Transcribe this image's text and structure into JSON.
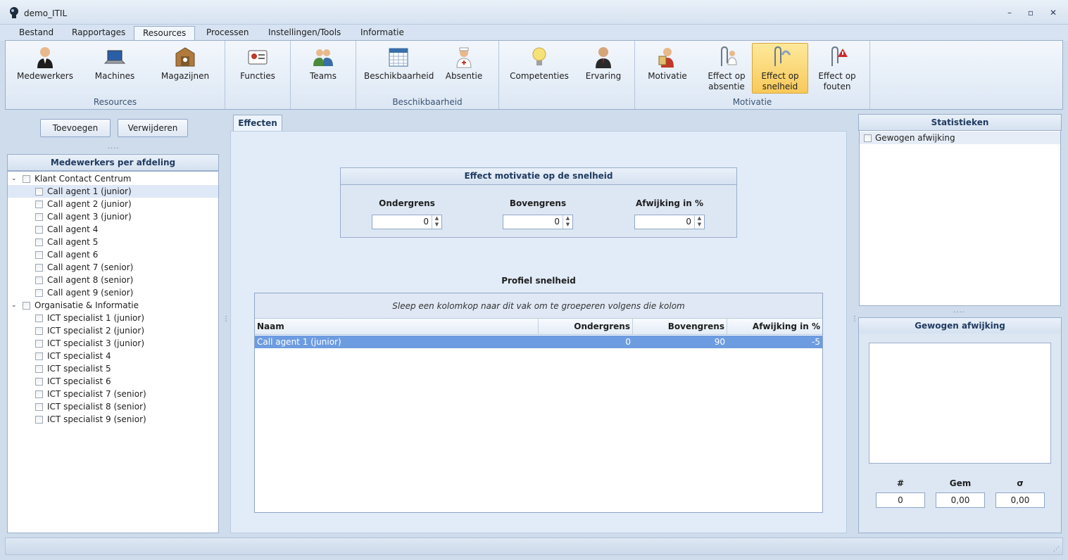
{
  "window": {
    "title": "demo_ITIL",
    "controls": [
      "–",
      "▫",
      "✕"
    ]
  },
  "tabs": [
    "Bestand",
    "Rapportages",
    "Resources",
    "Processen",
    "Instellingen/Tools",
    "Informatie"
  ],
  "active_tab": "Resources",
  "ribbon": {
    "groups": [
      {
        "label": "Resources",
        "buttons": [
          "Medewerkers",
          "Machines",
          "Magazijnen"
        ]
      },
      {
        "label": "",
        "buttons": [
          "Functies"
        ]
      },
      {
        "label": "",
        "buttons": [
          "Teams"
        ]
      },
      {
        "label": "Beschikbaarheid",
        "buttons": [
          "Beschikbaarheid",
          "Absentie"
        ]
      },
      {
        "label": "",
        "buttons": [
          "Competenties",
          "Ervaring"
        ]
      },
      {
        "label": "Motivatie",
        "buttons": [
          "Motivatie",
          "Effect op absentie",
          "Effect op snelheid",
          "Effect op fouten"
        ]
      }
    ],
    "active_button": "Effect op snelheid",
    "motivatie_lines": {
      "absentie": [
        "Effect op",
        "absentie"
      ],
      "snelheid": [
        "Effect op",
        "snelheid"
      ],
      "fouten": [
        "Effect op",
        "fouten"
      ]
    }
  },
  "left": {
    "add_button": "Toevoegen",
    "remove_button": "Verwijderen",
    "dots": "....",
    "panel_title": "Medewerkers per afdeling",
    "groups": [
      {
        "name": "Klant Contact Centrum",
        "items": [
          "Call agent 1 (junior)",
          "Call agent 2 (junior)",
          "Call agent 3 (junior)",
          "Call agent 4",
          "Call agent 5",
          "Call agent 6",
          "Call agent 7 (senior)",
          "Call agent 8 (senior)",
          "Call agent 9 (senior)"
        ]
      },
      {
        "name": "Organisatie & Informatie",
        "items": [
          "ICT specialist 1 (junior)",
          "ICT specialist 2 (junior)",
          "ICT specialist 3 (junior)",
          "ICT specialist 4",
          "ICT specialist 5",
          "ICT specialist 6",
          "ICT specialist 7 (senior)",
          "ICT specialist 8 (senior)",
          "ICT specialist 9 (senior)"
        ]
      }
    ],
    "selected_item": "Call agent 1 (junior)"
  },
  "center": {
    "tab": "Effecten",
    "effect_title": "Effect motivatie op de snelheid",
    "fields": [
      {
        "label": "Ondergrens",
        "value": "0"
      },
      {
        "label": "Bovengrens",
        "value": "0"
      },
      {
        "label": "Afwijking in %",
        "value": "0"
      }
    ],
    "profile_title": "Profiel snelheid",
    "group_hint": "Sleep een kolomkop naar dit vak om te groeperen volgens die kolom",
    "columns": [
      "Naam",
      "Ondergrens",
      "Bovengrens",
      "Afwijking in %"
    ],
    "rows": [
      {
        "naam": "Call agent 1 (junior)",
        "ondergrens": "0",
        "bovengrens": "90",
        "afwijking": "-5"
      }
    ]
  },
  "right": {
    "stats_title": "Statistieken",
    "stats_items": [
      "Gewogen afwijking"
    ],
    "dots": "....",
    "chart_title": "Gewogen afwijking",
    "summary_labels": [
      "#",
      "Gem",
      "σ"
    ],
    "summary_values": [
      "0",
      "0,00",
      "0,00"
    ]
  },
  "colors": {
    "accent": "#f8c95a",
    "selection": "#6d9ce0",
    "frame": "#cfdcec"
  }
}
